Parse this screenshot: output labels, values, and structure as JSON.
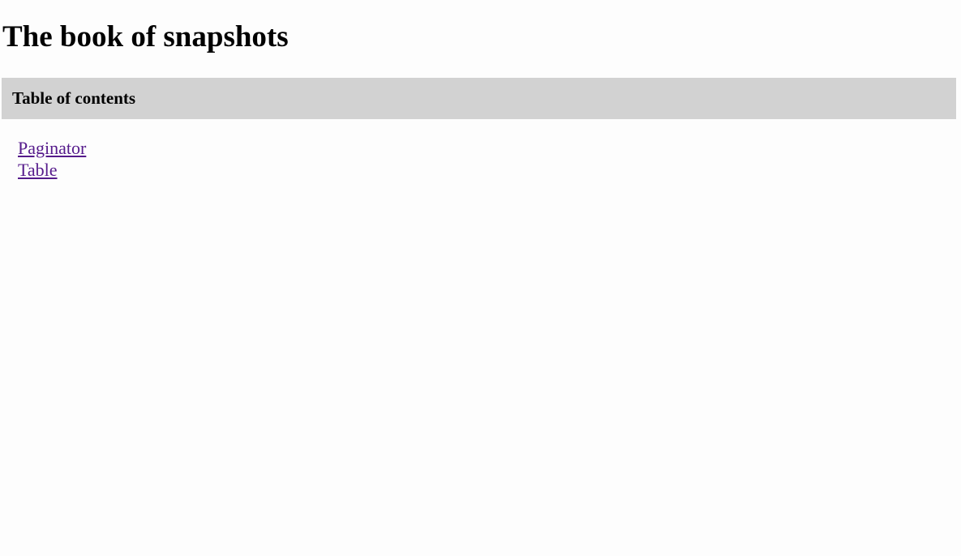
{
  "page": {
    "title": "The book of snapshots"
  },
  "toc": {
    "heading": "Table of contents",
    "items": [
      {
        "label": "Paginator"
      },
      {
        "label": "Table"
      }
    ]
  },
  "colors": {
    "background": "#fdfdfd",
    "toc_header_bg": "#d2d2d2",
    "visited_link": "#551a8b",
    "text": "#000000"
  }
}
